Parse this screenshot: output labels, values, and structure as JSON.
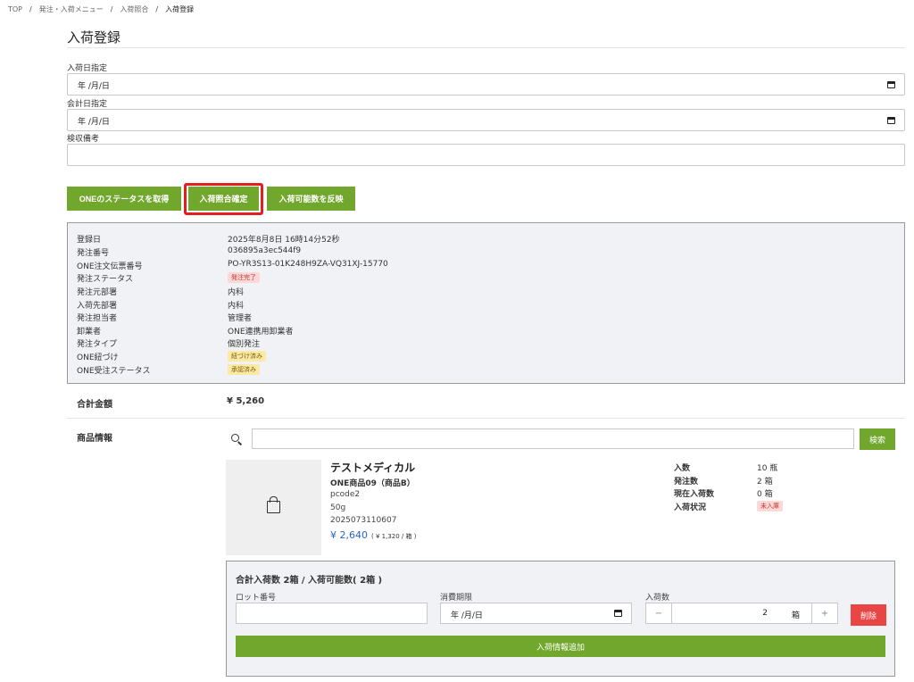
{
  "breadcrumb": [
    "TOP",
    "発注・入荷メニュー",
    "入荷照合",
    "入荷登録"
  ],
  "breadcrumb_sep": "/",
  "page": {
    "title": "入荷登録"
  },
  "form": {
    "arrival_date": {
      "label": "入荷日指定",
      "value": "年 /月/日"
    },
    "accounting_date": {
      "label": "会計日指定",
      "value": "年 /月/日"
    },
    "inspection_note": {
      "label": "検収備考",
      "value": ""
    }
  },
  "actions": {
    "get_one_status": "ONEのステータスを取得",
    "confirm_matching": "入荷照合確定",
    "reflect_available": "入荷可能数を反映"
  },
  "order_info": [
    {
      "label": "登録日",
      "value": "2025年8月8日 16時14分52秒"
    },
    {
      "label": "発注番号",
      "value": "036895a3ec544f9"
    },
    {
      "label": "ONE注文伝票番号",
      "value": "PO-YR3S13-01K248H9ZA-VQ31XJ-15770"
    },
    {
      "label": "発注ステータス",
      "badge": "発注完了",
      "badge_color": "#fcd8d8"
    },
    {
      "label": "発注元部署",
      "value": "内科"
    },
    {
      "label": "入荷先部署",
      "value": "内科"
    },
    {
      "label": "発注担当者",
      "value": "管理者"
    },
    {
      "label": "卸業者",
      "value": "ONE連携用卸業者"
    },
    {
      "label": "発注タイプ",
      "value": "個別発注"
    },
    {
      "label": "ONE紐づけ",
      "badge": "紐づけ済み",
      "badge_color": "#fce9a6"
    },
    {
      "label": "ONE受注ステータス",
      "badge": "承認済み",
      "badge_color": "#fce9a6"
    }
  ],
  "total": {
    "label": "合計金額",
    "value": "¥ 5,260"
  },
  "products": {
    "label": "商品情報",
    "search_button": "検索",
    "search_value": "",
    "item": {
      "maker": "テストメディカル",
      "name": "ONE商品09（商品B）",
      "code": "pcode2",
      "size": "50g",
      "jan": "2025073110607",
      "price": "¥ 2,640",
      "unit_price": "( ¥ 1,320 / 箱 )",
      "stats": [
        {
          "label": "入数",
          "value": "10 瓶"
        },
        {
          "label": "発注数",
          "value": "2 箱"
        },
        {
          "label": "現在入荷数",
          "value": "0 箱"
        },
        {
          "label": "入荷状況",
          "badge": "未入庫"
        }
      ]
    }
  },
  "receive": {
    "title": "合計入荷数 2箱 / 入荷可能数( 2箱 )",
    "lot_label": "ロット番号",
    "lot_value": "",
    "expiry_label": "消費期限",
    "expiry_value": "年 /月/日",
    "qty_label": "入荷数",
    "qty_value": "2",
    "qty_unit": "箱",
    "minus": "−",
    "plus": "+",
    "delete_button": "削除",
    "add_button": "入荷情報追加"
  }
}
